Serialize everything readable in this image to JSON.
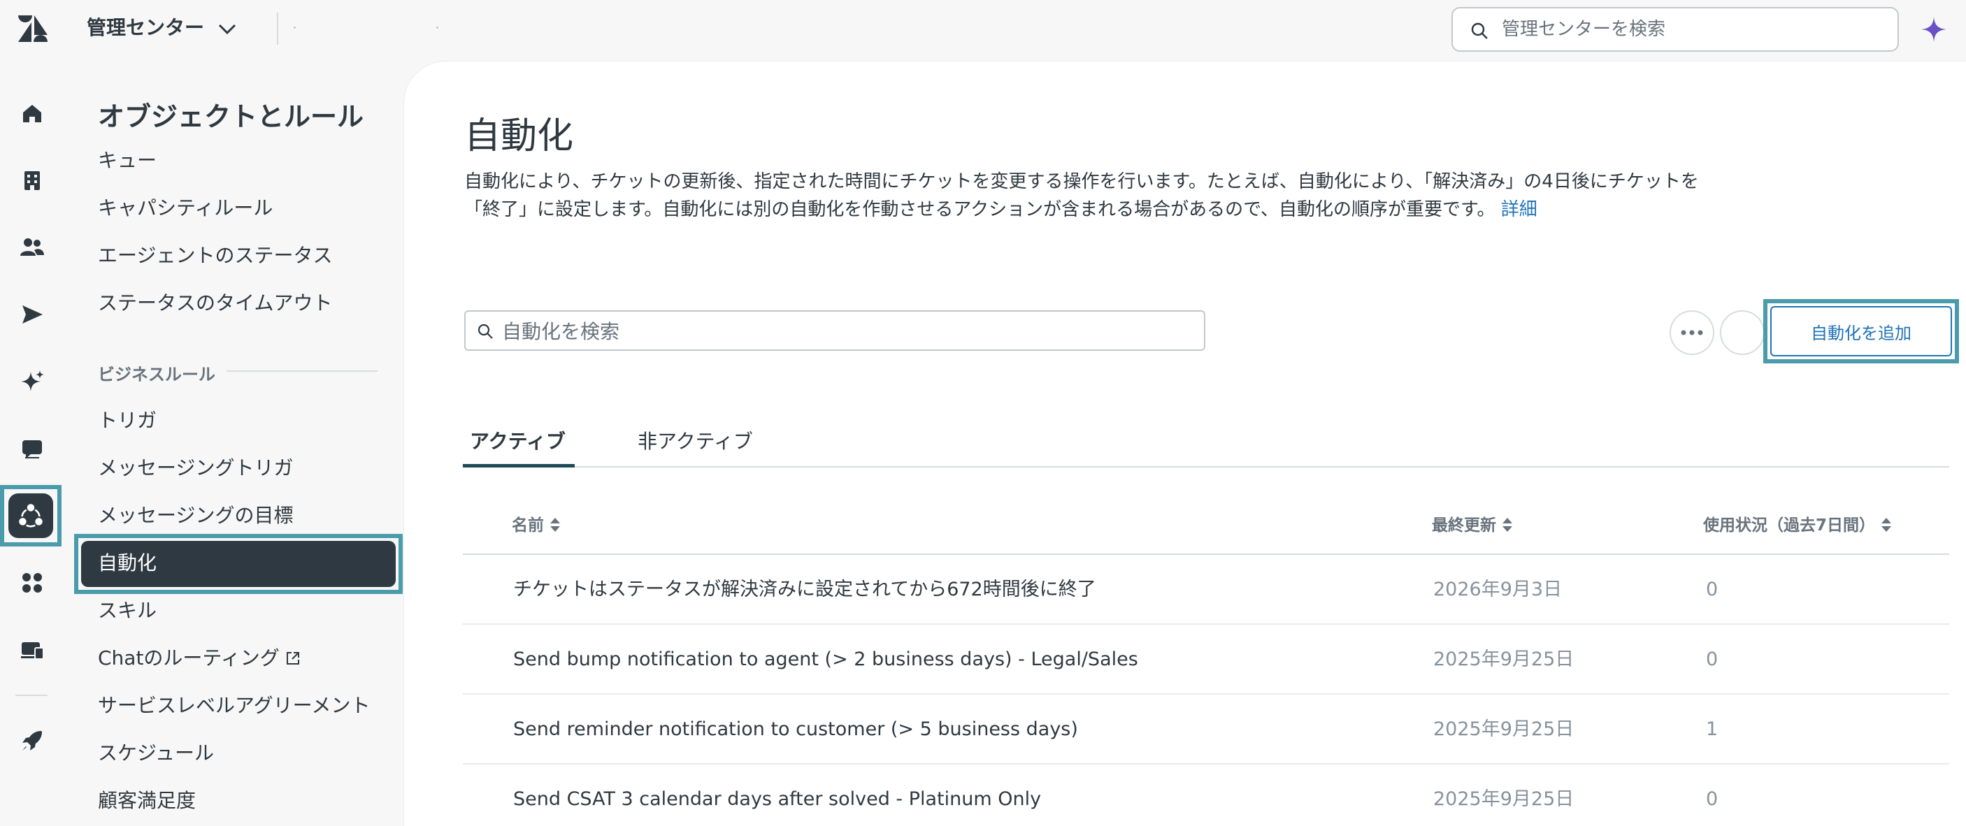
{
  "header": {
    "product_name": "管理センター",
    "search_placeholder": "管理センターを検索"
  },
  "nav": {
    "title": "オブジェクトとルール",
    "items_top": [
      "キュー",
      "キャパシティルール",
      "エージェントのステータス",
      "ステータスのタイムアウト"
    ],
    "section_label": "ビジネスルール",
    "items_business": [
      "トリガ",
      "メッセージングトリガ",
      "メッセージングの目標",
      "自動化",
      "スキル",
      "Chatのルーティング",
      "サービスレベルアグリーメント",
      "スケジュール",
      "顧客満足度"
    ],
    "active_item": "自動化"
  },
  "page": {
    "title": "自動化",
    "description": "自動化により、チケットの更新後、指定された時間にチケットを変更する操作を行います。たとえば、自動化により、「解決済み」の4日後にチケットを「終了」に設定します。自動化には別の自動化を作動させるアクションが含まれる場合があるので、自動化の順序が重要です。",
    "learn_more": "詳細",
    "search_placeholder": "自動化を検索",
    "add_button": "自動化を追加"
  },
  "tabs": {
    "active": "アクティブ",
    "inactive": "非アクティブ"
  },
  "table": {
    "columns": [
      "名前",
      "最終更新",
      "使用状況（過去7日間）"
    ],
    "rows": [
      {
        "name": "チケットはステータスが解決済みに設定されてから672時間後に終了",
        "updated": "2026年9月3日",
        "usage": "0"
      },
      {
        "name": "Send bump notification to agent (> 2 business days) - Legal/Sales",
        "updated": "2025年9月25日",
        "usage": "0"
      },
      {
        "name": "Send reminder notification to customer (> 5 business days)",
        "updated": "2025年9月25日",
        "usage": "1"
      },
      {
        "name": "Send CSAT 3 calendar days after solved - Platinum Only",
        "updated": "2025年9月25日",
        "usage": "0"
      }
    ]
  },
  "icons": {
    "rail": [
      "home-icon",
      "building-icon",
      "people-icon",
      "send-icon",
      "sparkle-icon",
      "chat-icon",
      "objects-rules-icon",
      "apps-icon",
      "workspace-icon",
      "rocket-icon"
    ],
    "ai": "ai-sparkle-icon"
  },
  "colors": {
    "accent_blue": "#1f73b7",
    "highlight_frame": "#4a9bab",
    "active_nav_bg": "#2f3941",
    "ai_purple": "#6a4fc7"
  }
}
